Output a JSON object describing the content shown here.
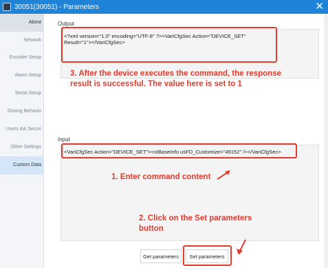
{
  "window": {
    "title": "30051(30051) - Parameters",
    "close_glyph": "✕"
  },
  "sidebar": {
    "items": [
      {
        "label": "About"
      },
      {
        "label": "Network"
      },
      {
        "label": "Encoder Setup"
      },
      {
        "label": "Alarm Setup"
      },
      {
        "label": "Serial Setup"
      },
      {
        "label": "Driving Behavio"
      },
      {
        "label": "Users && Securi"
      },
      {
        "label": "Other Settings"
      },
      {
        "label": "Custom Data"
      }
    ],
    "active_index": 8
  },
  "output": {
    "label": "Output",
    "value_line1": "<?xml version=\"1.0\" encoding=\"UTF-8\" ?><VariCfgSec Action=\"DEVICE_SET\"",
    "value_line2": "Result=\"1\"></VariCfgSec>"
  },
  "input": {
    "label": "Input",
    "value": "<VariCfgSec Action=\"DEVICE_SET\"><stBaseInfo usFD_Customize=\"49152\" /></VariCfgSec>"
  },
  "annotations": {
    "step3": "3. After the device executes the command, the response result is successful. The value here is set to 1",
    "step1": "1. Enter command content",
    "step2": "2. Click on the Set parameters button"
  },
  "buttons": {
    "get": "Get parameters",
    "set": "Set parameters"
  },
  "colors": {
    "titlebar": "#1f84d8",
    "annotation": "#e23b2e",
    "active_nav": "#d5e6f8"
  }
}
